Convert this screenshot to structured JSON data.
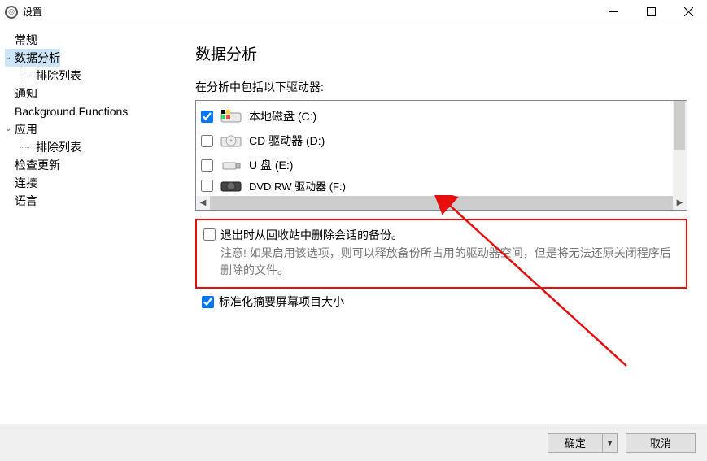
{
  "window": {
    "title": "设置"
  },
  "sidebar": {
    "items": [
      {
        "label": "常规",
        "expandable": false
      },
      {
        "label": "数据分析",
        "expandable": true,
        "selected": true
      },
      {
        "label": "排除列表",
        "child": true
      },
      {
        "label": "通知",
        "expandable": false
      },
      {
        "label": "Background Functions",
        "expandable": false
      },
      {
        "label": "应用",
        "expandable": true
      },
      {
        "label": "排除列表",
        "child": true
      },
      {
        "label": "检查更新",
        "expandable": false
      },
      {
        "label": "连接",
        "expandable": false
      },
      {
        "label": "语言",
        "expandable": false
      }
    ]
  },
  "main": {
    "heading": "数据分析",
    "subhead": "在分析中包括以下驱动器:",
    "drives": [
      {
        "label": "本地磁盘 (C:)",
        "checked": true,
        "icon": "hdd"
      },
      {
        "label": "CD 驱动器 (D:)",
        "checked": false,
        "icon": "cd"
      },
      {
        "label": "U 盘 (E:)",
        "checked": false,
        "icon": "usb"
      },
      {
        "label": "DVD RW 驱动器 (F:)",
        "checked": false,
        "icon": "dvd"
      }
    ],
    "highlight_option": {
      "label": "退出时从回收站中删除会话的备份。",
      "note": "注意! 如果启用该选项，则可以释放备份所占用的驱动器空间，但是将无法还原关闭程序后删除的文件。",
      "checked": false
    },
    "normalize_option": {
      "label": "标准化摘要屏幕项目大小",
      "checked": true
    }
  },
  "footer": {
    "ok": "确定",
    "cancel": "取消"
  }
}
